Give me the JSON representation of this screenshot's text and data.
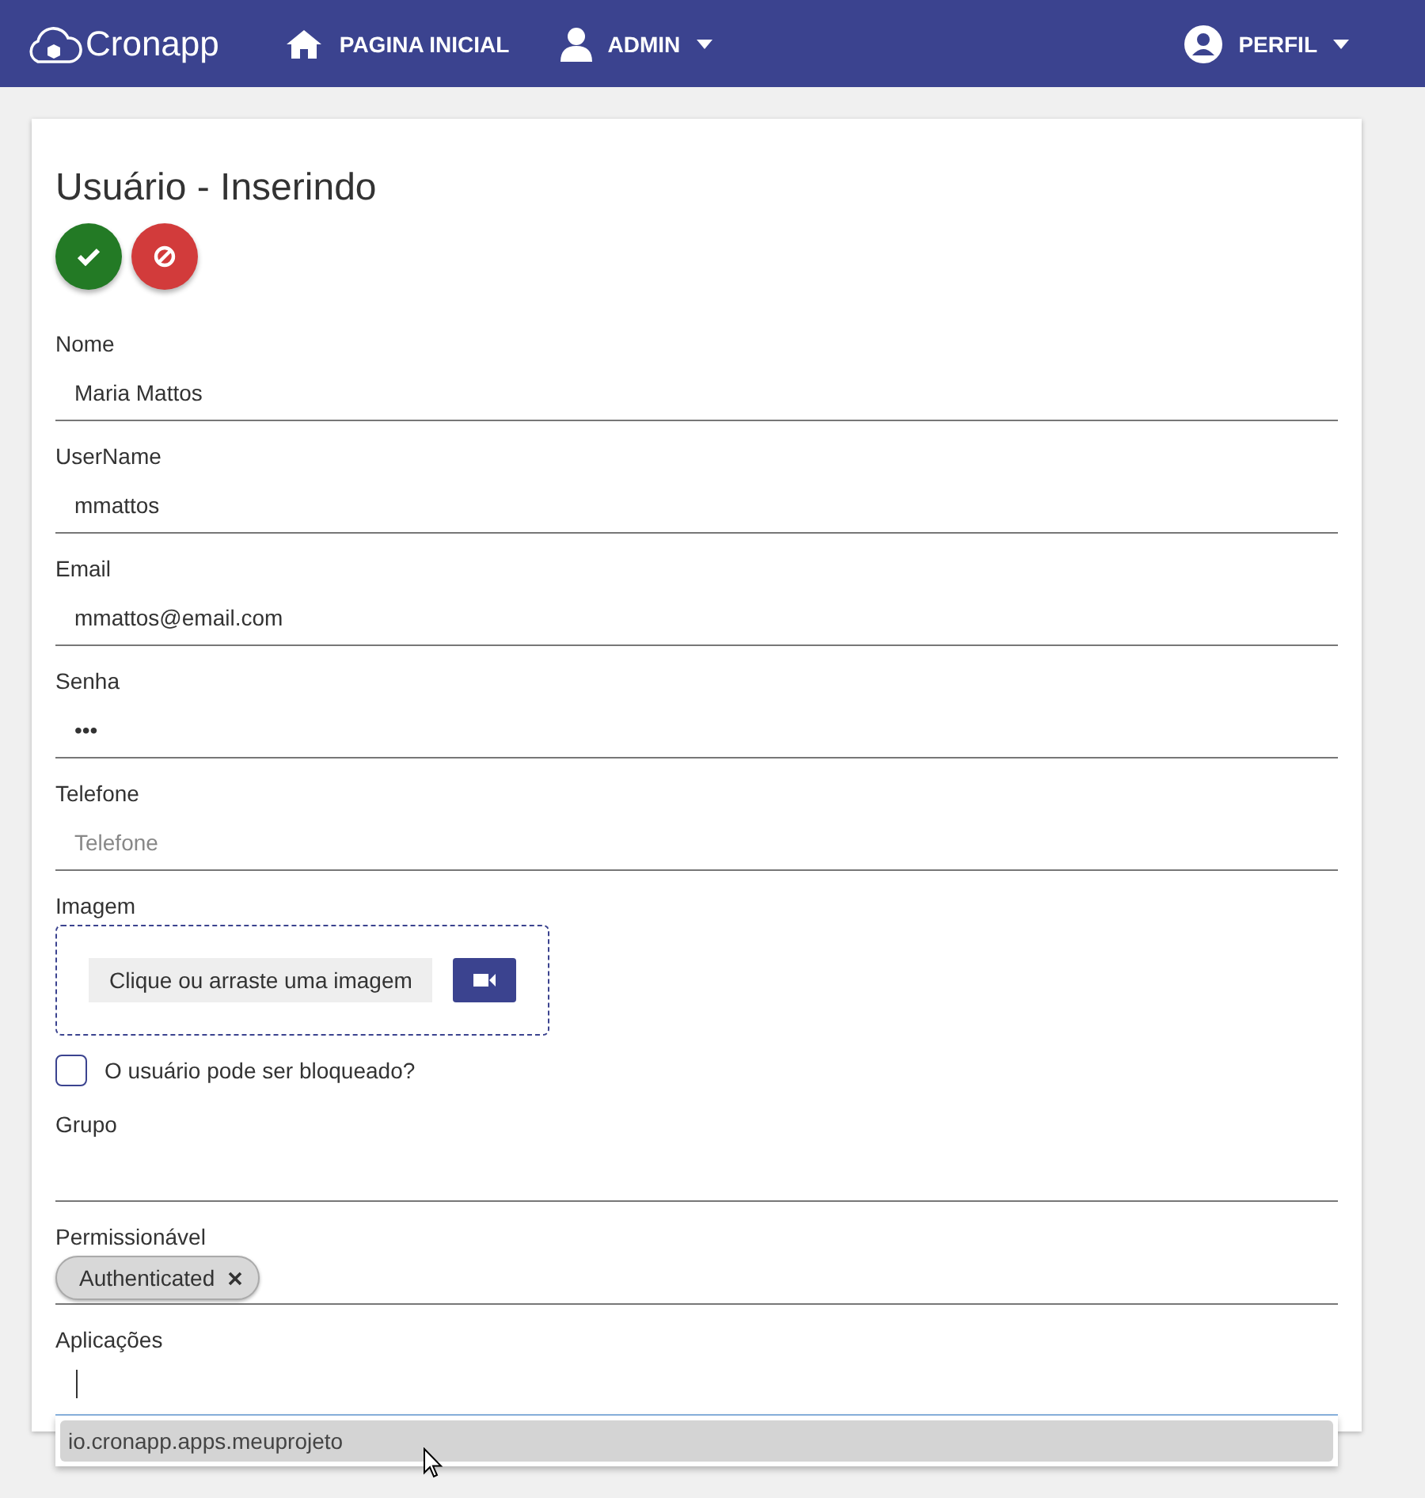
{
  "navbar": {
    "logo": "Cronapp",
    "items": [
      {
        "label": "PAGINA INICIAL",
        "kind": "home",
        "dropdown": false
      },
      {
        "label": "ADMIN",
        "kind": "user",
        "dropdown": true
      }
    ],
    "profile": {
      "label": "PERFIL",
      "dropdown": true
    }
  },
  "form": {
    "title": "Usuário - Inserindo",
    "fields": [
      {
        "label": "Nome",
        "value": "Maria Mattos"
      },
      {
        "label": "UserName",
        "value": "mmattos"
      },
      {
        "label": "Email",
        "value": "mmattos@email.com"
      },
      {
        "label": "Senha",
        "value": "•••"
      },
      {
        "label": "Telefone",
        "placeholder": "Telefone"
      }
    ],
    "image": {
      "label": "Imagem",
      "button": "Clique ou arraste uma imagem"
    },
    "blocked": {
      "label": "O usuário pode ser bloqueado?",
      "checked": false
    },
    "group": {
      "label": "Grupo"
    },
    "permissions": {
      "label": "Permissionável",
      "tags": [
        "Authenticated"
      ]
    },
    "applications": {
      "label": "Aplicações",
      "suggestions": [
        {
          "label": "io.cronapp.apps.meuprojeto",
          "selected": true
        }
      ]
    }
  }
}
